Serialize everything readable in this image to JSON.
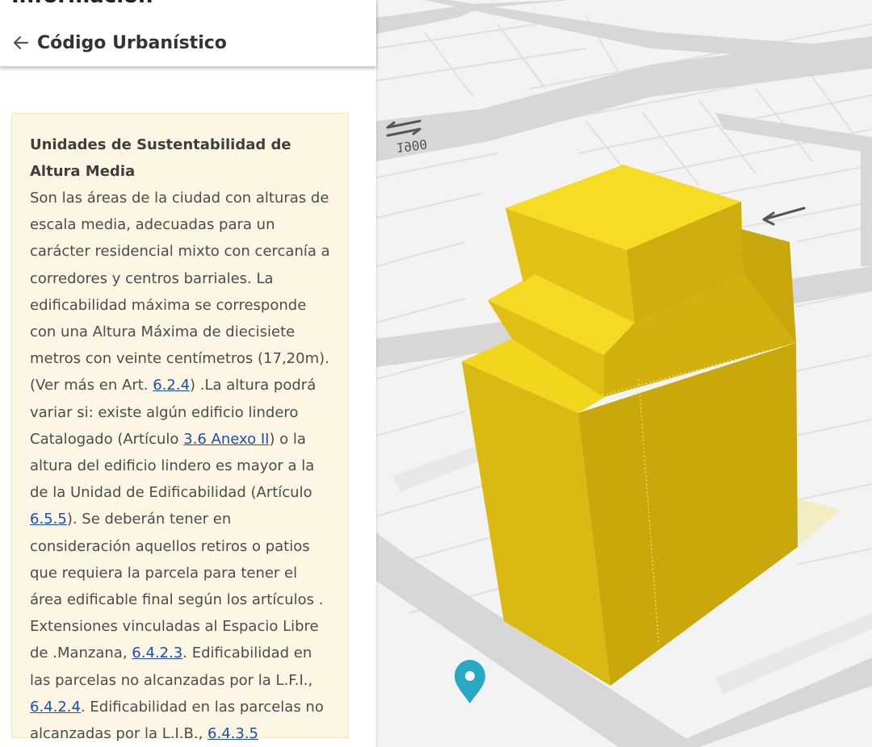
{
  "header": {
    "clipped_title": "Información",
    "back_title": "Código Urbanístico"
  },
  "card": {
    "heading": "Unidades de Sustentabilidad de Altura Media",
    "text_1": "Son las áreas de la ciudad con alturas de escala media, adecuadas para un carácter residencial mixto con cercanía a corredores y centros barriales. La edificabilidad máxima se corresponde con una Altura Máxima de diecisiete metros con veinte centímetros (17,20m). (Ver más en Art. ",
    "link_1": "6.2.4",
    "text_2": ") .La altura podrá variar si: existe algún edificio lindero Catalogado (Artículo ",
    "link_2": "3.6 Anexo II",
    "text_3": ") o la altura del edificio lindero es mayor a la de la Unidad de Edificabilidad (Artículo ",
    "link_3": "6.5.5",
    "text_4": "). Se deberán tener en consideración aquellos retiros o patios que requiera la parcela para tener el área edificable final según los artículos . Extensiones vinculadas al Espacio Libre de .Manzana, ",
    "link_4": "6.4.2.3",
    "text_5": ". Edificabilidad en las parcelas no alcanzadas por la L.F.I., ",
    "link_5": "6.4.2.4",
    "text_6": ". Edificabilidad en las parcelas no alcanzadas por la L.I.B., ",
    "link_6": "6.4.3.5"
  },
  "map": {
    "street_number": "1900",
    "building_color": "#f2d21a",
    "pin_color": "#29a8c4"
  }
}
